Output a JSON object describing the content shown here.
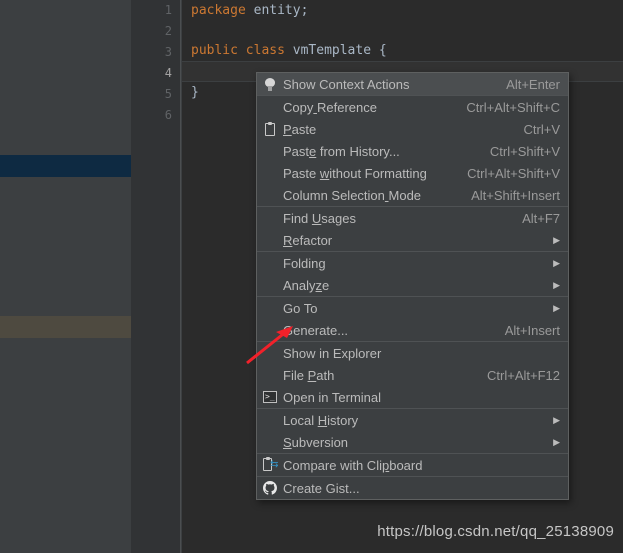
{
  "editor": {
    "line_numbers": [
      "1",
      "2",
      "3",
      "4",
      "5",
      "6"
    ],
    "current_line": "4",
    "code": {
      "l1_kw": "package",
      "l1_rest": " entity;",
      "l3_kw1": "public",
      "l3_kw2": "class",
      "l3_ident": "vmTemplate",
      "l3_brace": "{",
      "l5_brace": "}"
    }
  },
  "watermark": {
    "text": "https://blog.csdn.net/qq_25138909"
  },
  "context_menu": {
    "groups": [
      {
        "items": [
          {
            "label": "Show Context Actions",
            "shortcut": "Alt+Enter",
            "icon": "lightbulb-icon",
            "arrow": false,
            "highlight": true
          }
        ]
      },
      {
        "items": [
          {
            "label": "Copy Reference",
            "shortcut": "Ctrl+Alt+Shift+C",
            "icon": "",
            "arrow": false,
            "highlight": false
          },
          {
            "label": "Paste",
            "shortcut": "Ctrl+V",
            "icon": "clipboard-icon",
            "arrow": false,
            "highlight": false
          },
          {
            "label": "Paste from History...",
            "shortcut": "Ctrl+Shift+V",
            "icon": "",
            "arrow": false,
            "highlight": false
          },
          {
            "label": "Paste without Formatting",
            "shortcut": "Ctrl+Alt+Shift+V",
            "icon": "",
            "arrow": false,
            "highlight": false
          },
          {
            "label": "Column Selection Mode",
            "shortcut": "Alt+Shift+Insert",
            "icon": "",
            "arrow": false,
            "highlight": false
          }
        ]
      },
      {
        "items": [
          {
            "label": "Find Usages",
            "shortcut": "Alt+F7",
            "icon": "",
            "arrow": false,
            "highlight": false
          },
          {
            "label": "Refactor",
            "shortcut": "",
            "icon": "",
            "arrow": true,
            "highlight": false
          }
        ]
      },
      {
        "items": [
          {
            "label": "Folding",
            "shortcut": "",
            "icon": "",
            "arrow": true,
            "highlight": false
          },
          {
            "label": "Analyze",
            "shortcut": "",
            "icon": "",
            "arrow": true,
            "highlight": false
          }
        ]
      },
      {
        "items": [
          {
            "label": "Go To",
            "shortcut": "",
            "icon": "",
            "arrow": true,
            "highlight": false
          },
          {
            "label": "Generate...",
            "shortcut": "Alt+Insert",
            "icon": "",
            "arrow": false,
            "highlight": false
          }
        ]
      },
      {
        "items": [
          {
            "label": "Show in Explorer",
            "shortcut": "",
            "icon": "",
            "arrow": false,
            "highlight": false
          },
          {
            "label": "File Path",
            "shortcut": "Ctrl+Alt+F12",
            "icon": "",
            "arrow": false,
            "highlight": false
          },
          {
            "label": "Open in Terminal",
            "shortcut": "",
            "icon": "terminal-icon",
            "arrow": false,
            "highlight": false
          }
        ]
      },
      {
        "items": [
          {
            "label": "Local History",
            "shortcut": "",
            "icon": "",
            "arrow": true,
            "highlight": false
          },
          {
            "label": "Subversion",
            "shortcut": "",
            "icon": "",
            "arrow": true,
            "highlight": false
          }
        ]
      },
      {
        "items": [
          {
            "label": "Compare with Clipboard",
            "shortcut": "",
            "icon": "compare-clipboard-icon",
            "arrow": false,
            "highlight": false
          }
        ]
      },
      {
        "items": [
          {
            "label": "Create Gist...",
            "shortcut": "",
            "icon": "github-icon",
            "arrow": false,
            "highlight": false
          }
        ]
      }
    ]
  },
  "markers": {
    "selection_color": "#0E2A42",
    "modified_color": "#4E4A40"
  },
  "colors": {
    "menu_background": "#3C3F41",
    "menu_border": "#5E6060",
    "editor_background": "#2B2B2B",
    "gutter_background": "#313335",
    "keyword": "#CC7832",
    "identifier": "#A9B7C6",
    "annotation_arrow": "#F2212A"
  }
}
